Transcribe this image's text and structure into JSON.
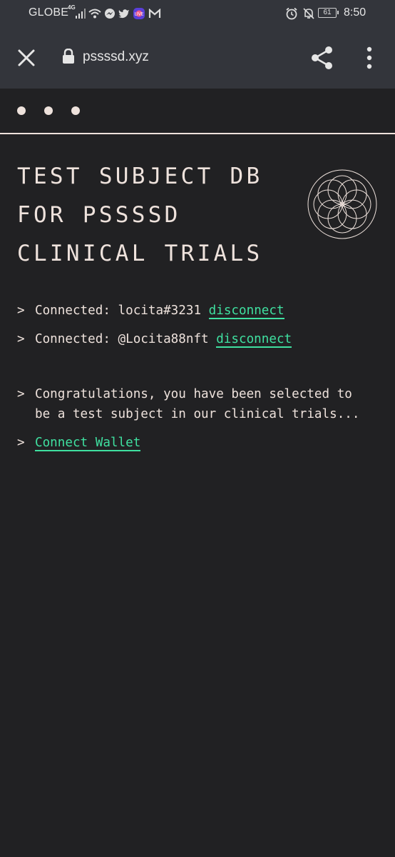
{
  "status_bar": {
    "carrier": "GLOBE",
    "network_type": "4G",
    "battery": "61",
    "time": "8:50",
    "icons_left": [
      "signal-icon",
      "wifi-icon",
      "messenger-icon",
      "twitter-icon",
      "app-badge-icon",
      "gmail-icon"
    ],
    "icons_right": [
      "alarm-icon",
      "mute-icon",
      "battery-icon"
    ]
  },
  "browser": {
    "url": "pssssd.xyz"
  },
  "page": {
    "title_lines": [
      "TEST SUBJECT DB",
      "FOR PSSSSD",
      "CLINICAL TRIALS"
    ],
    "prompt": ">",
    "connections": [
      {
        "text": "Connected: locita#3231",
        "action": "disconnect"
      },
      {
        "text": "Connected: @Locita88nft",
        "action": "disconnect"
      }
    ],
    "message_lines": [
      "Congratulations, you have been selected to",
      "be a test subject in our clinical trials..."
    ],
    "connect_wallet": "Connect Wallet"
  },
  "colors": {
    "background": "#212123",
    "toolbar": "#33353b",
    "text": "#eee2dc",
    "link": "#3fe0a0"
  }
}
